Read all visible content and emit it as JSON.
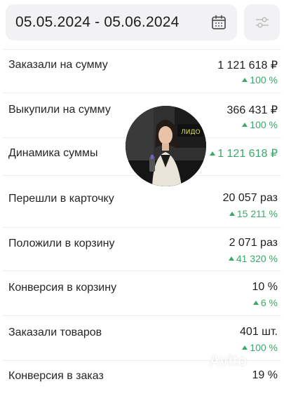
{
  "date_range": "05.05.2024 - 05.06.2024",
  "icons": {
    "calendar": "calendar-icon",
    "filter": "sliders-icon"
  },
  "colors": {
    "positive": "#3ba86b",
    "field_bg": "#f2f2f4"
  },
  "metrics": [
    {
      "label": "Заказали на сумму",
      "value": "1 121 618 ₽",
      "delta": "100 %"
    },
    {
      "label": "Выкупили на сумму",
      "value": "366 431 ₽",
      "delta": "100 %"
    },
    {
      "label": "Динамика суммы",
      "value": "1 121 618 ₽"
    },
    {
      "label": "Перешли в карточку",
      "value": "20 057 раз",
      "delta": "15 211 %"
    },
    {
      "label": "Положили в корзину",
      "value": "2 071 раз",
      "delta": "41 320 %"
    },
    {
      "label": "Конверсия в корзину",
      "value": "10 %",
      "delta": "6 %"
    },
    {
      "label": "Заказали товаров",
      "value": "401 шт.",
      "delta": "100 %"
    },
    {
      "label": "Конверсия в заказ",
      "value": "19 %"
    }
  ],
  "avatar_sign": "ЛИДО",
  "watermark": "Avito"
}
